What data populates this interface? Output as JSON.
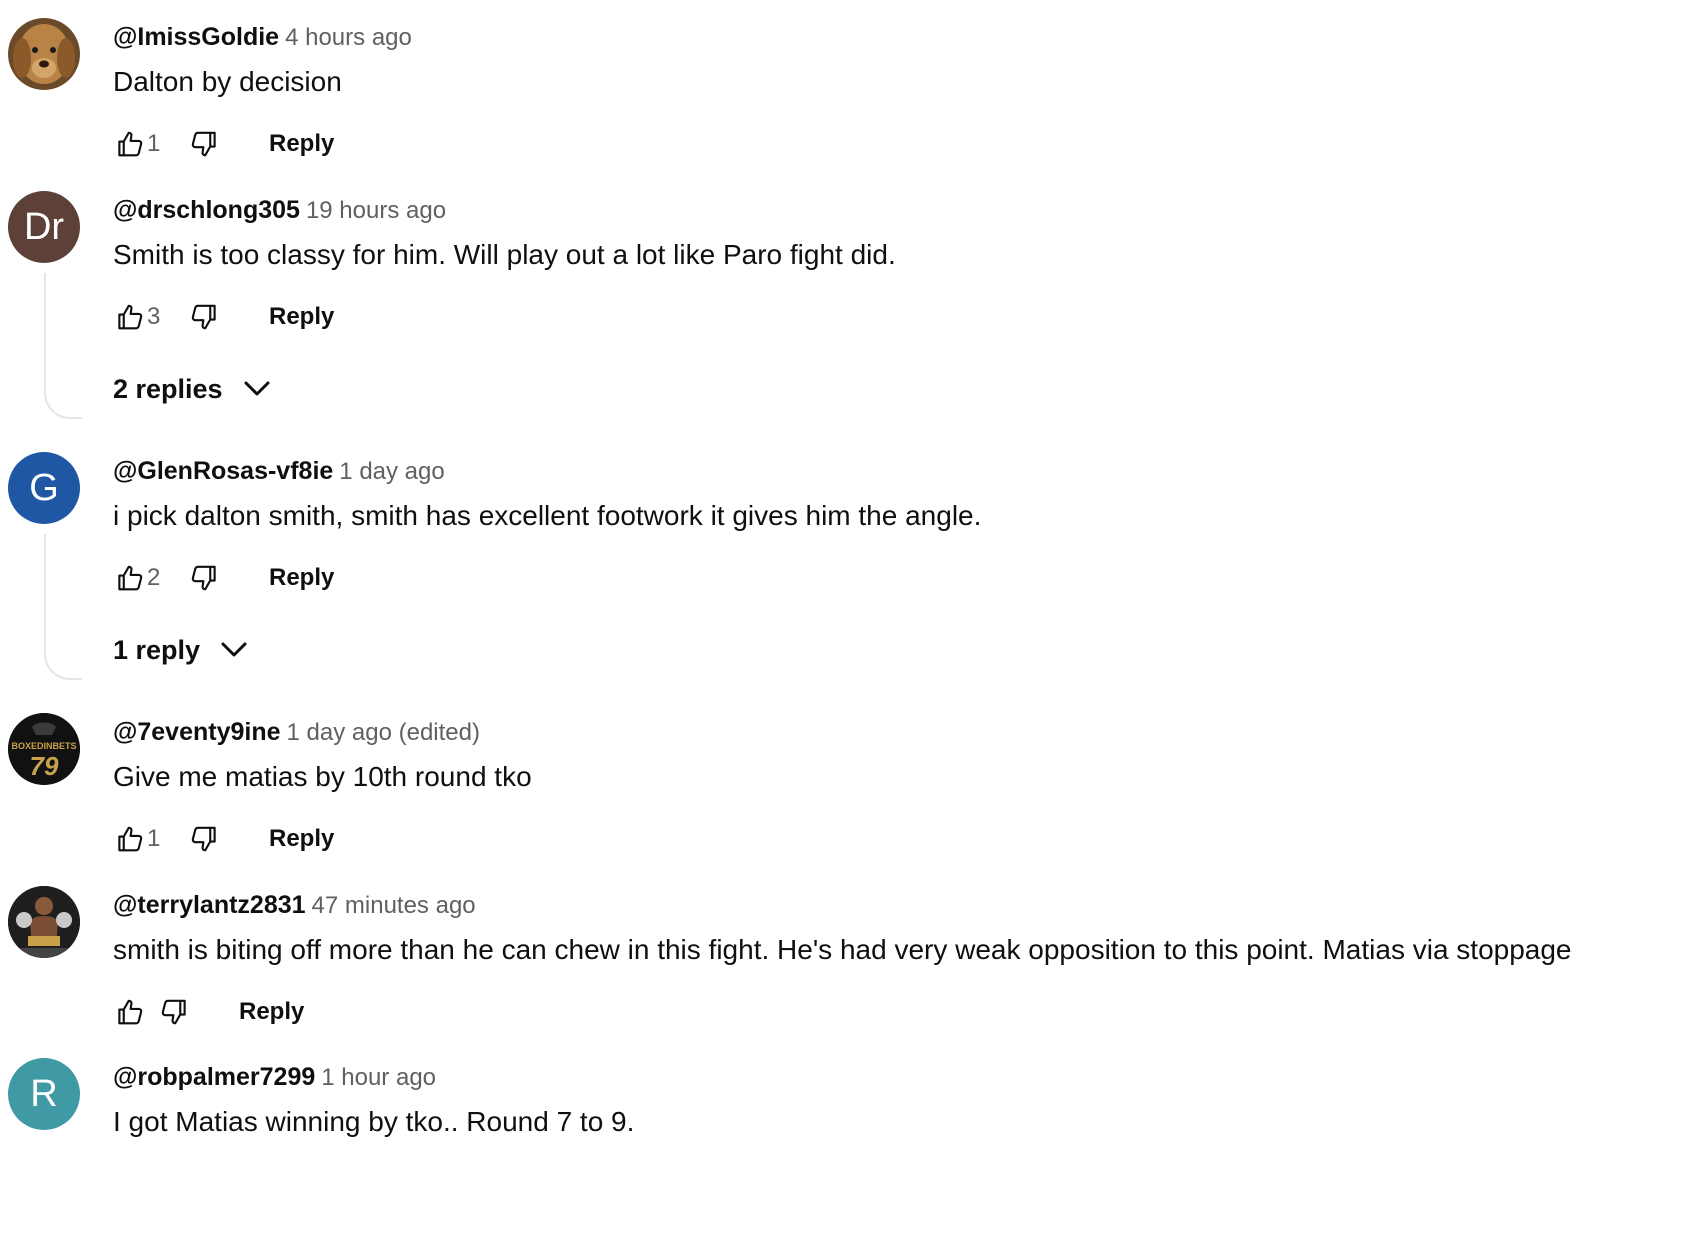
{
  "comments": [
    {
      "author": "@ImissGoldie",
      "time": "4 hours ago",
      "text": "Dalton by decision",
      "likes": "1",
      "reply_label": "Reply",
      "avatar": {
        "kind": "image",
        "icon": "golden-retriever-photo",
        "color": "#8a5a2b"
      }
    },
    {
      "author": "@drschlong305",
      "time": "19 hours ago",
      "text": "Smith is too classy for him. Will play out a lot like Paro fight did.",
      "likes": "3",
      "reply_label": "Reply",
      "avatar": {
        "kind": "initials",
        "initials": "Dr",
        "color": "#5d4037"
      },
      "replies_label": "2 replies"
    },
    {
      "author": "@GlenRosas-vf8ie",
      "time": "1 day ago",
      "text": "i pick dalton smith, smith has excellent footwork it gives him the angle.",
      "likes": "2",
      "reply_label": "Reply",
      "avatar": {
        "kind": "initials",
        "initials": "G",
        "color": "#1f57a4"
      },
      "replies_label": "1 reply"
    },
    {
      "author": "@7eventy9ine",
      "time": "1 day ago (edited)",
      "text": "Give me matias by 10th round tko",
      "likes": "1",
      "reply_label": "Reply",
      "avatar": {
        "kind": "logo",
        "logo_text": "BOXEDINBETS",
        "logo_number": "79",
        "color": "#111111",
        "accent": "#c8a24a"
      }
    },
    {
      "author": "@terrylantz2831",
      "time": "47 minutes ago",
      "text": "smith is biting off more than he can chew in this fight.  He's had very weak opposition to this point.  Matias via stoppage",
      "likes": "",
      "reply_label": "Reply",
      "avatar": {
        "kind": "image",
        "icon": "boxer-photo",
        "color": "#2a2a2a"
      }
    },
    {
      "author": "@robpalmer7299",
      "time": "1 hour ago",
      "text": "I got Matias winning by tko.. Round 7 to 9.",
      "avatar": {
        "kind": "initials",
        "initials": "R",
        "color": "#3f9aa5"
      }
    }
  ]
}
